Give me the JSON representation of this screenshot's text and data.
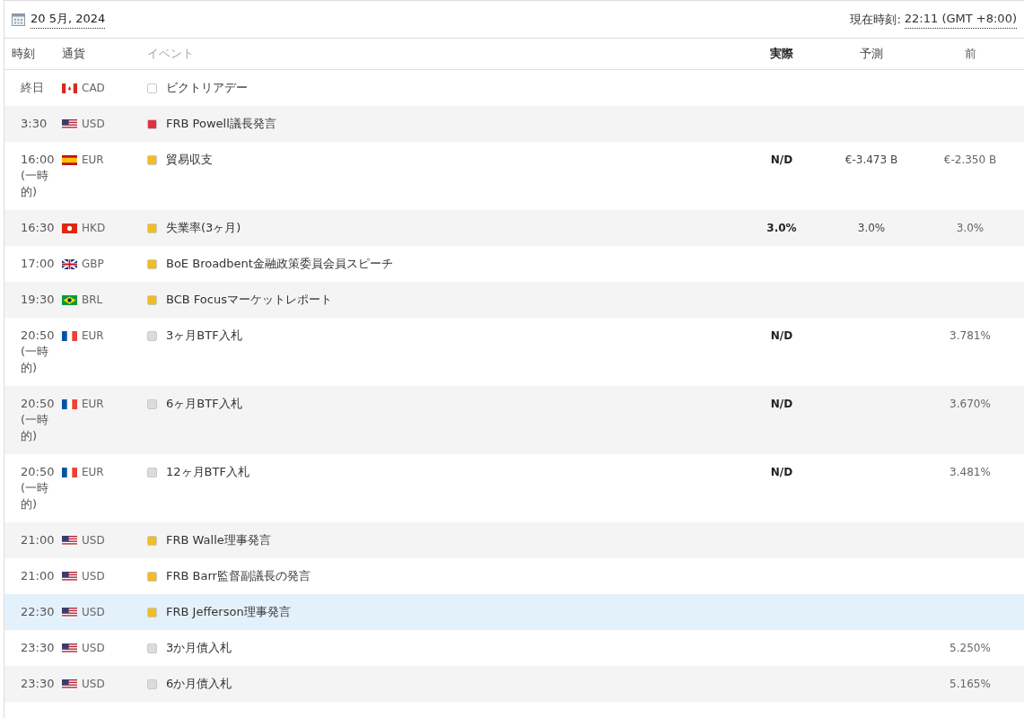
{
  "header": {
    "date": "20 5月, 2024",
    "current_time_label": "現在時刻:",
    "current_time": "22:11 (GMT +8:00)"
  },
  "columns": [
    "時刻",
    "通貨",
    "イベント",
    "実際",
    "予測",
    "前"
  ],
  "rows": [
    {
      "time": "終日",
      "kind": "ca",
      "currency": "CAD",
      "color": "#ffffff",
      "event": "ビクトリアデー",
      "actual": "",
      "forecast": "",
      "previous": "",
      "selected": false
    },
    {
      "time": "3:30",
      "kind": "us",
      "currency": "USD",
      "color": "#e0313e",
      "event": "FRB Powell議長発言",
      "actual": "",
      "forecast": "",
      "previous": "",
      "selected": false
    },
    {
      "time": "16:00 (一時的)",
      "kind": "es",
      "currency": "EUR",
      "color": "#f2bd22",
      "event": "貿易収支",
      "actual": "N/D",
      "forecast": "€-3.473 B",
      "previous": "€-2.350 B",
      "selected": false
    },
    {
      "time": "16:30",
      "kind": "hk",
      "currency": "HKD",
      "color": "#f2bd22",
      "event": "失業率(3ヶ月)",
      "actual": "3.0%",
      "forecast": "3.0%",
      "previous": "3.0%",
      "selected": false
    },
    {
      "time": "17:00",
      "kind": "gb",
      "currency": "GBP",
      "color": "#f2bd22",
      "event": "BoE Broadbent金融政策委員会員スピーチ",
      "actual": "",
      "forecast": "",
      "previous": "",
      "selected": false
    },
    {
      "time": "19:30",
      "kind": "br",
      "currency": "BRL",
      "color": "#f2bd22",
      "event": "BCB Focusマーケットレポート",
      "actual": "",
      "forecast": "",
      "previous": "",
      "selected": false
    },
    {
      "time": "20:50 (一時的)",
      "kind": "fr",
      "currency": "EUR",
      "color": "#dcdcdc",
      "event": "3ヶ月BTF入札",
      "actual": "N/D",
      "forecast": "",
      "previous": "3.781%",
      "selected": false
    },
    {
      "time": "20:50 (一時的)",
      "kind": "fr",
      "currency": "EUR",
      "color": "#dcdcdc",
      "event": "6ヶ月BTF入札",
      "actual": "N/D",
      "forecast": "",
      "previous": "3.670%",
      "selected": false
    },
    {
      "time": "20:50 (一時的)",
      "kind": "fr",
      "currency": "EUR",
      "color": "#dcdcdc",
      "event": "12ヶ月BTF入札",
      "actual": "N/D",
      "forecast": "",
      "previous": "3.481%",
      "selected": false
    },
    {
      "time": "21:00",
      "kind": "us",
      "currency": "USD",
      "color": "#f2bd22",
      "event": "FRB Walle理事発言",
      "actual": "",
      "forecast": "",
      "previous": "",
      "selected": false
    },
    {
      "time": "21:00",
      "kind": "us",
      "currency": "USD",
      "color": "#f2bd22",
      "event": "FRB Barr監督副議長の発言",
      "actual": "",
      "forecast": "",
      "previous": "",
      "selected": false
    },
    {
      "time": "22:30",
      "kind": "us",
      "currency": "USD",
      "color": "#f2bd22",
      "event": "FRB Jefferson理事発言",
      "actual": "",
      "forecast": "",
      "previous": "",
      "selected": true
    },
    {
      "time": "23:30",
      "kind": "us",
      "currency": "USD",
      "color": "#dcdcdc",
      "event": "3か月債入札",
      "actual": "",
      "forecast": "",
      "previous": "5.250%",
      "selected": false
    },
    {
      "time": "23:30",
      "kind": "us",
      "currency": "USD",
      "color": "#dcdcdc",
      "event": "6か月債入札",
      "actual": "",
      "forecast": "",
      "previous": "5.165%",
      "selected": false
    }
  ]
}
